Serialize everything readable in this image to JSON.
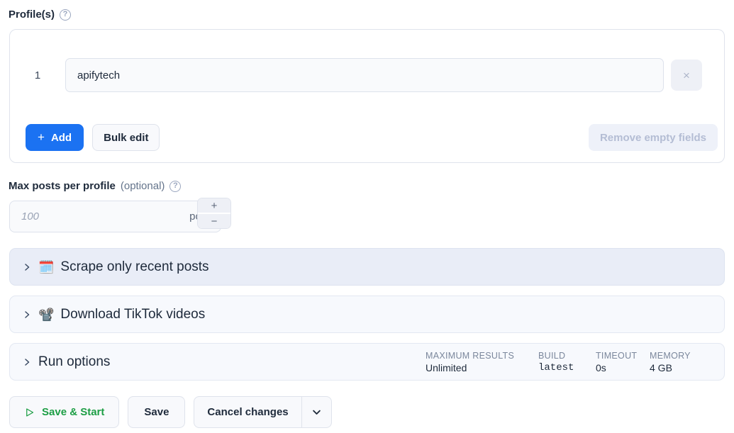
{
  "profiles": {
    "label": "Profile(s)",
    "help_icon": "question-circle-icon",
    "rows": [
      {
        "index": "1",
        "value": "apifytech",
        "remove_icon": "×"
      }
    ],
    "add_button": {
      "label": "Add",
      "icon": "plus-icon"
    },
    "bulk_edit_button": "Bulk edit",
    "remove_empty_fields_button": "Remove empty fields"
  },
  "max_posts": {
    "label": "Max posts per profile",
    "optional": "(optional)",
    "help_icon": "question-circle-icon",
    "placeholder": "100",
    "value": "",
    "unit": "posts",
    "increment_icon": "+",
    "decrement_icon": "−"
  },
  "sections": [
    {
      "title": "Scrape only recent posts",
      "emoji": "🗓️",
      "icon_name": "calendar-icon",
      "chevron": "chevron-right-icon",
      "expanded": false
    },
    {
      "title": "Download TikTok videos",
      "emoji": "📽️",
      "icon_name": "film-projector-icon",
      "chevron": "chevron-right-icon",
      "expanded": false
    }
  ],
  "run_options": {
    "title": "Run options",
    "chevron": "chevron-right-icon",
    "meta": [
      {
        "key": "MAXIMUM RESULTS",
        "value": "Unlimited",
        "mono": false
      },
      {
        "key": "BUILD",
        "value": "latest",
        "mono": true
      },
      {
        "key": "TIMEOUT",
        "value": "0s",
        "mono": false
      },
      {
        "key": "MEMORY",
        "value": "4 GB",
        "mono": false
      }
    ]
  },
  "footer": {
    "save_and_start": {
      "label": "Save & Start",
      "icon": "play-icon"
    },
    "save": "Save",
    "cancel_changes": "Cancel changes",
    "cancel_caret_icon": "chevron-down-icon"
  },
  "colors": {
    "primary": "#1b72f2",
    "success": "#1d9e45",
    "text": "#1e2a3b",
    "muted": "#7b879c",
    "section_active_bg": "#e9edf7",
    "section_bg": "#f7f9fd"
  }
}
